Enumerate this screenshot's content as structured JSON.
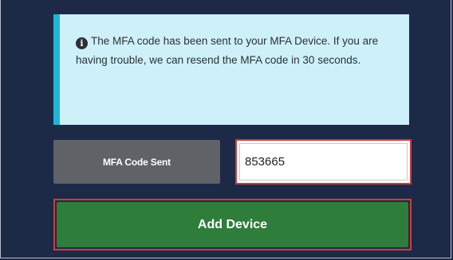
{
  "alert": {
    "icon": "info-icon",
    "icon_glyph": "i",
    "message": "The MFA code has been sent to your MFA Device. If you are having trouble, we can resend the MFA code in 30 seconds."
  },
  "mfa": {
    "label": "MFA Code Sent",
    "code_value": "853665"
  },
  "actions": {
    "add_device_label": "Add Device"
  },
  "colors": {
    "background": "#1c2a47",
    "alert_bg": "#cdf0f9",
    "alert_accent": "#1fb3d8",
    "label_bg": "#5f6266",
    "button_green": "#2e7d3a",
    "highlight_red": "#d33a3a"
  }
}
